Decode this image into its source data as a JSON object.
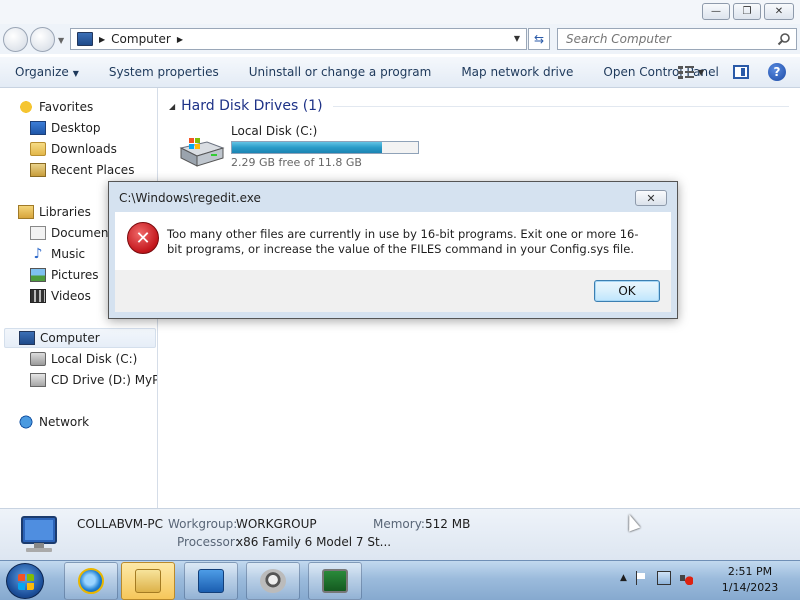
{
  "window": {
    "buttons": {
      "minimize": "—",
      "maximize": "❐",
      "close": "✕"
    }
  },
  "address": {
    "breadcrumb": "Computer",
    "search_placeholder": "Search Computer"
  },
  "toolbar": {
    "organize": "Organize",
    "system_properties": "System properties",
    "uninstall": "Uninstall or change a program",
    "map_drive": "Map network drive",
    "control_panel": "Open Control Panel",
    "help": "?"
  },
  "nav": {
    "favorites": "Favorites",
    "desktop": "Desktop",
    "downloads": "Downloads",
    "recent": "Recent Places",
    "libraries": "Libraries",
    "documents": "Documents",
    "music": "Music",
    "pictures": "Pictures",
    "videos": "Videos",
    "computer": "Computer",
    "local_disk": "Local Disk (C:)",
    "cd_drive": "CD Drive (D:) MyPal",
    "network": "Network"
  },
  "content": {
    "group_title": "Hard Disk Drives (1)",
    "drive": {
      "name": "Local Disk (C:)",
      "free_text": "2.29 GB free of 11.8 GB",
      "used_fraction": 0.806
    }
  },
  "details": {
    "pc_name": "COLLABVM-PC",
    "workgroup_label": "Workgroup:",
    "workgroup_value": "WORKGROUP",
    "memory_label": "Memory:",
    "memory_value": "512 MB",
    "processor_label": "Processor:",
    "processor_value": "x86 Family 6 Model 7 St..."
  },
  "dialog": {
    "title": "C:\\Windows\\regedit.exe",
    "close": "✕",
    "message": "Too many other files are currently in use by 16-bit programs. Exit one or more 16-bit programs, or increase the value of the FILES command in your Config.sys file.",
    "ok": "OK",
    "error_glyph": "✕"
  },
  "taskbar": {
    "time": "2:51 PM",
    "date": "1/14/2023"
  },
  "colors": {
    "accent": "#1e3287",
    "drive_fill": "#2a9cc8",
    "error_red": "#c3161c"
  }
}
